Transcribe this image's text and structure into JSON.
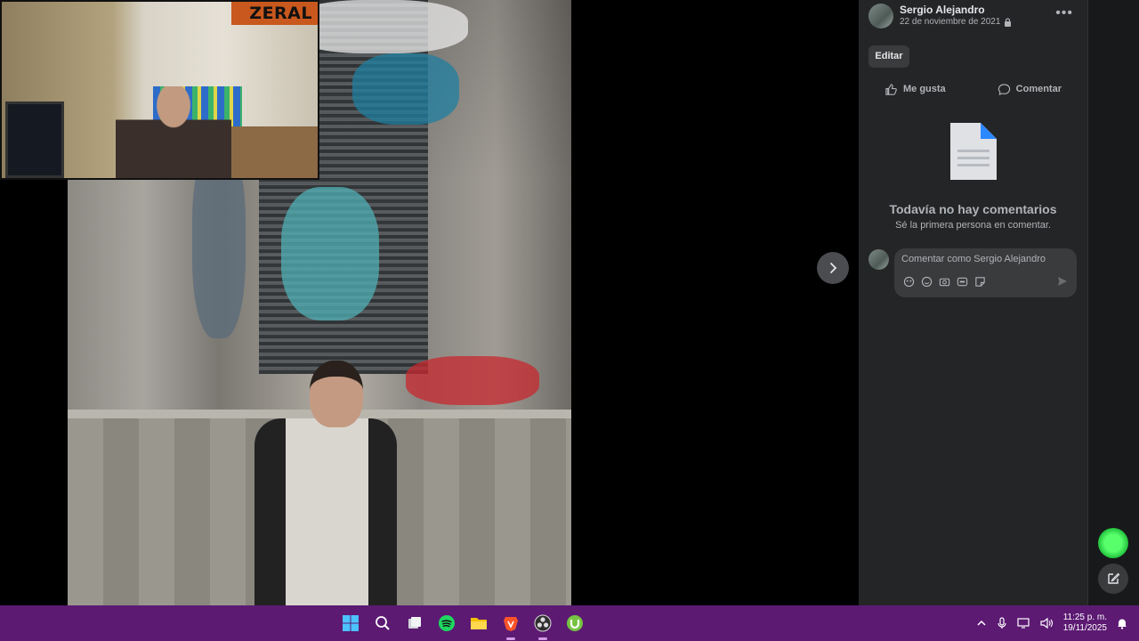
{
  "stream_overlay": {
    "label": "ZERAL"
  },
  "post": {
    "author": "Sergio Alejandro",
    "date": "22 de noviembre de 2021",
    "edit_label": "Editar",
    "like_label": "Me gusta",
    "comment_label": "Comentar"
  },
  "comments": {
    "empty_title": "Todavía no hay comentarios",
    "empty_subtitle": "Sé la primera persona en comentar.",
    "input_placeholder": "Comentar como Sergio Alejandro"
  },
  "taskbar": {
    "apps": [
      "start-icon",
      "search-icon",
      "task-view-icon",
      "spotify-icon",
      "file-explorer-icon",
      "brave-icon",
      "obs-icon",
      "utorrent-icon"
    ],
    "time": "11:25 p. m.",
    "date": "19/11/2025"
  },
  "colors": {
    "panel_bg": "#242526",
    "taskbar_bg": "#5c1a73",
    "text": "#e4e6eb",
    "muted": "#b0b3b8"
  }
}
